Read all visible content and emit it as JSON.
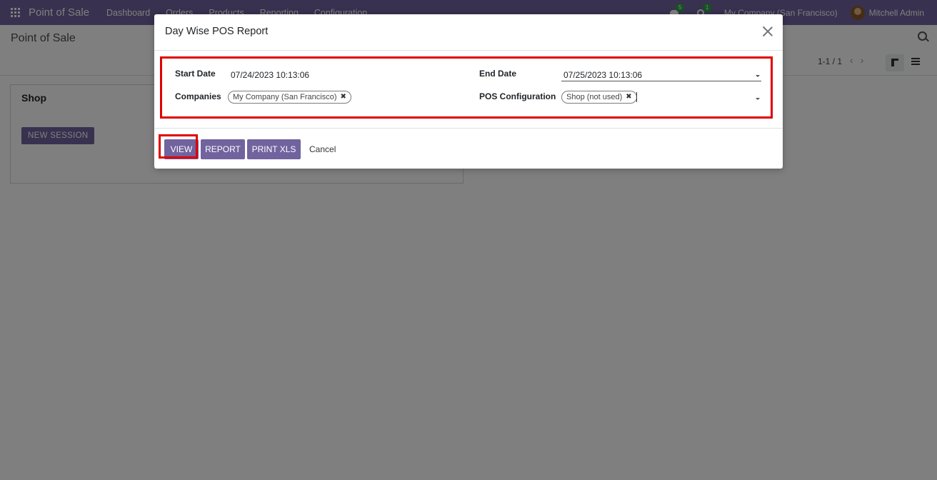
{
  "navbar": {
    "brand": "Point of Sale",
    "menu": [
      "Dashboard",
      "Orders",
      "Products",
      "Reporting",
      "Configuration"
    ],
    "messages_badge": "5",
    "activities_badge": "1",
    "company": "My Company (San Francisco)",
    "user": "Mitchell Admin"
  },
  "control_panel": {
    "title": "Point of Sale",
    "pager": "1-1 / 1"
  },
  "kanban": {
    "card_title": "Shop",
    "new_session_label": "NEW SESSION"
  },
  "dialog": {
    "title": "Day Wise POS Report",
    "start_date_label": "Start Date",
    "start_date_value": "07/24/2023 10:13:06",
    "end_date_label": "End Date",
    "end_date_value": "07/25/2023 10:13:06",
    "companies_label": "Companies",
    "companies_tag": "My Company (San Francisco)",
    "pos_config_label": "POS Configuration",
    "pos_config_tag": "Shop (not used)",
    "buttons": {
      "view": "VIEW",
      "report": "REPORT",
      "print_xls": "PRINT XLS",
      "cancel": "Cancel"
    }
  },
  "colors": {
    "brand": "#71639e",
    "highlight": "#e00000"
  }
}
